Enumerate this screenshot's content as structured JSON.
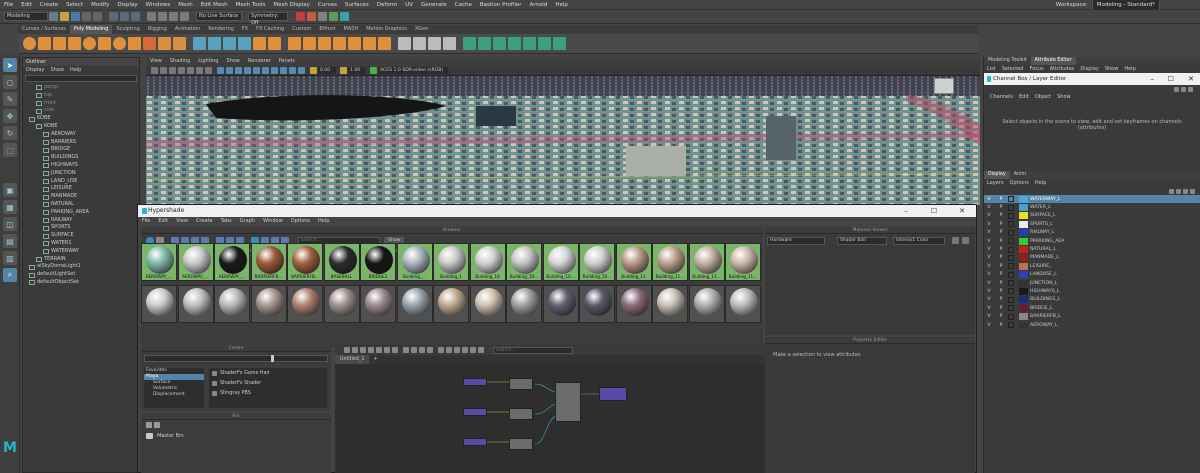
{
  "menubar": {
    "items": [
      "File",
      "Edit",
      "Create",
      "Select",
      "Modify",
      "Display",
      "Windows",
      "Mesh",
      "Edit Mesh",
      "Mesh Tools",
      "Mesh Display",
      "Curves",
      "Surfaces",
      "Deform",
      "UV",
      "Generate",
      "Cache",
      "Bastion Profiler",
      "Arnold",
      "Help"
    ],
    "workspace_label": "Workspace:",
    "workspace_value": "Modeling - Standard*"
  },
  "statusline": {
    "mode": "Modeling",
    "live_surface": "No Live Surface",
    "symmetry": "Symmetry: Off"
  },
  "shelf": {
    "tabs": [
      "Curves / Surfaces",
      "Poly Modeling",
      "Sculpting",
      "Rigging",
      "Animation",
      "Rendering",
      "FX",
      "FX Caching",
      "Custom",
      "Bifrost",
      "MASH",
      "Motion Graphics",
      "XGen"
    ],
    "active_tab": "Poly Modeling"
  },
  "outliner": {
    "title": "Outliner",
    "menu": [
      "Display",
      "Show",
      "Help"
    ],
    "items": [
      {
        "label": "persp",
        "depth": 1
      },
      {
        "label": "top",
        "depth": 1
      },
      {
        "label": "front",
        "depth": 1
      },
      {
        "label": "side",
        "depth": 1
      },
      {
        "label": "KOBE",
        "depth": 0
      },
      {
        "label": "KOBE",
        "depth": 1
      },
      {
        "label": "AEROWAY",
        "depth": 2
      },
      {
        "label": "BARRIERS",
        "depth": 2
      },
      {
        "label": "BRIDGE",
        "depth": 2
      },
      {
        "label": "BUILDINGS",
        "depth": 2
      },
      {
        "label": "HIGHWAYS",
        "depth": 2
      },
      {
        "label": "JUNCTION",
        "depth": 2
      },
      {
        "label": "LAND_USE",
        "depth": 2
      },
      {
        "label": "LEISURE",
        "depth": 2
      },
      {
        "label": "MANMADE",
        "depth": 2
      },
      {
        "label": "NATURAL",
        "depth": 2
      },
      {
        "label": "PARKING_AREA",
        "depth": 2
      },
      {
        "label": "RAILWAY",
        "depth": 2
      },
      {
        "label": "SPORTS",
        "depth": 2
      },
      {
        "label": "SURFACE",
        "depth": 2
      },
      {
        "label": "WATER1",
        "depth": 2
      },
      {
        "label": "WATERWAY",
        "depth": 2
      },
      {
        "label": "TERRAIN",
        "depth": 1
      },
      {
        "label": "aiSkyDomeLight1",
        "depth": 0
      },
      {
        "label": "defaultLightSet",
        "depth": 0
      },
      {
        "label": "defaultObjectSet",
        "depth": 0
      }
    ]
  },
  "viewport": {
    "menu": [
      "View",
      "Shading",
      "Lighting",
      "Show",
      "Renderer",
      "Panels"
    ],
    "near_value": "0.00",
    "far_value": "1.00",
    "colorspace": "ACES 1.0 SDR-video (sRGB)"
  },
  "hypershade": {
    "title": "Hypershade",
    "menu": [
      "File",
      "Edit",
      "View",
      "Create",
      "Tabs",
      "Graph",
      "Window",
      "Options",
      "Help"
    ],
    "browser_header": "Browser",
    "search_placeholder": "Search...",
    "show_label": "Show",
    "browser_tabs": [
      "Materials",
      "Textures",
      "Utilities",
      "Rendering",
      "Lights",
      "Cameras",
      "Shading Groups",
      "Bake Sets",
      "Projects",
      "Asset Nodes"
    ],
    "active_browser_tab": "Materials",
    "materials_row1": [
      {
        "label": "AEROWAY_...",
        "color": "#7fb8a8"
      },
      {
        "label": "AEROWAY_...",
        "color": "#c8c8c8"
      },
      {
        "label": "AEROWAY_...",
        "color": "#1a1a1a"
      },
      {
        "label": "BARRIERFB...",
        "color": "#9a5a3a"
      },
      {
        "label": "BARRIERFB...",
        "color": "#a06040"
      },
      {
        "label": "BASEBALL",
        "color": "#2c2c2c"
      },
      {
        "label": "BRIDGE1",
        "color": "#151515"
      },
      {
        "label": "Building_...",
        "color": "#a8b4c0"
      },
      {
        "label": "Building_1",
        "color": "#c8c8c8"
      },
      {
        "label": "Building_10",
        "color": "#d0d0d0"
      },
      {
        "label": "Building_10...",
        "color": "#c4c4c4"
      },
      {
        "label": "Building_10...",
        "color": "#d4d4d4"
      },
      {
        "label": "Building_10...",
        "color": "#cfcfcf"
      },
      {
        "label": "Building_11",
        "color": "#b89888"
      },
      {
        "label": "Building_11...",
        "color": "#bca08c"
      },
      {
        "label": "Building_11...",
        "color": "#c0b0a0"
      },
      {
        "label": "Building_11...",
        "color": "#c8b8a8"
      }
    ],
    "materials_row2": [
      {
        "color": "#cccccc"
      },
      {
        "color": "#c0c0c0"
      },
      {
        "color": "#b8b8b8"
      },
      {
        "color": "#a89890"
      },
      {
        "color": "#b08070"
      },
      {
        "color": "#a09090"
      },
      {
        "color": "#9c8890"
      },
      {
        "color": "#9aa4ac"
      },
      {
        "color": "#c0a890"
      },
      {
        "color": "#d0c0b0"
      },
      {
        "color": "#a0a0a0"
      },
      {
        "color": "#606070"
      },
      {
        "color": "#5a5a6a"
      },
      {
        "color": "#8a6a7a"
      },
      {
        "color": "#c8c0b8"
      },
      {
        "color": "#b0b0b0"
      },
      {
        "color": "#bcbcbc"
      }
    ],
    "material_viewer": {
      "header": "Material Viewer",
      "renderer": "Hardware",
      "shape": "Shader Ball",
      "env": "Interior1 Color"
    },
    "create": {
      "header": "Create",
      "categories": [
        "Favorites",
        "Maya",
        "Surface",
        "Volumetric",
        "Displacement"
      ],
      "items": [
        "ShaderFx Game Hair",
        "ShaderFx Shader",
        "Stingray PBS"
      ]
    },
    "bin": {
      "header": "Bin",
      "master": "Master Bin"
    },
    "graph": {
      "tab": "Untitled_1",
      "add_tab": "+"
    },
    "property_editor": {
      "header": "Property Editor",
      "message": "Make a selection to view attributes"
    }
  },
  "rightdock": {
    "tabs": [
      "Modeling Toolkit",
      "Attribute Editor"
    ],
    "active_tab": "Attribute Editor",
    "ae_menu": [
      "List",
      "Selected",
      "Focus",
      "Attributes",
      "Display",
      "Show",
      "Help"
    ],
    "channelbox_title": "Channel Box / Layer Editor",
    "channel_menu": [
      "Channels",
      "Edit",
      "Object",
      "Show"
    ],
    "channel_message": "Select objects in the scene to view, edit and set keyframes on channels (attributes)",
    "layer_tabs": [
      "Display",
      "Anim"
    ],
    "layer_menu": [
      "Layers",
      "Options",
      "Help"
    ],
    "layers": [
      {
        "name": "WATERWAY_L",
        "color": "#4fa6d6",
        "sel": true
      },
      {
        "name": "WATER_L",
        "color": "#46a0d0",
        "sel": false
      },
      {
        "name": "SURFACE_L",
        "color": "#e8e020",
        "sel": false
      },
      {
        "name": "SPORTS_L",
        "color": "#e8e8e8",
        "sel": false
      },
      {
        "name": "RAILWAY_L",
        "color": "#2a3ab0",
        "sel": false
      },
      {
        "name": "PPARKING_AEA",
        "color": "#30d030",
        "sel": false
      },
      {
        "name": "NATURAL_L",
        "color": "#c02020",
        "sel": false
      },
      {
        "name": "MANMADE_L",
        "color": "#902020",
        "sel": false
      },
      {
        "name": "LEISURE_",
        "color": "#c07050",
        "sel": false
      },
      {
        "name": "LANDUSE_L",
        "color": "#2a40c0",
        "sel": false
      },
      {
        "name": "JUNCTION_L",
        "color": "#333333",
        "sel": false
      },
      {
        "name": "HIGHWAYS_L",
        "color": "#1a1a1a",
        "sel": false
      },
      {
        "name": "BUILDINGS_L",
        "color": "#1a2a80",
        "sel": false
      },
      {
        "name": "BRIDGE_L",
        "color": "#6a1a3a",
        "sel": false
      },
      {
        "name": "BARRIERFB_L",
        "color": "#888888",
        "sel": false
      },
      {
        "name": "AEROWAY_L",
        "color": "#333333",
        "sel": false
      }
    ]
  }
}
